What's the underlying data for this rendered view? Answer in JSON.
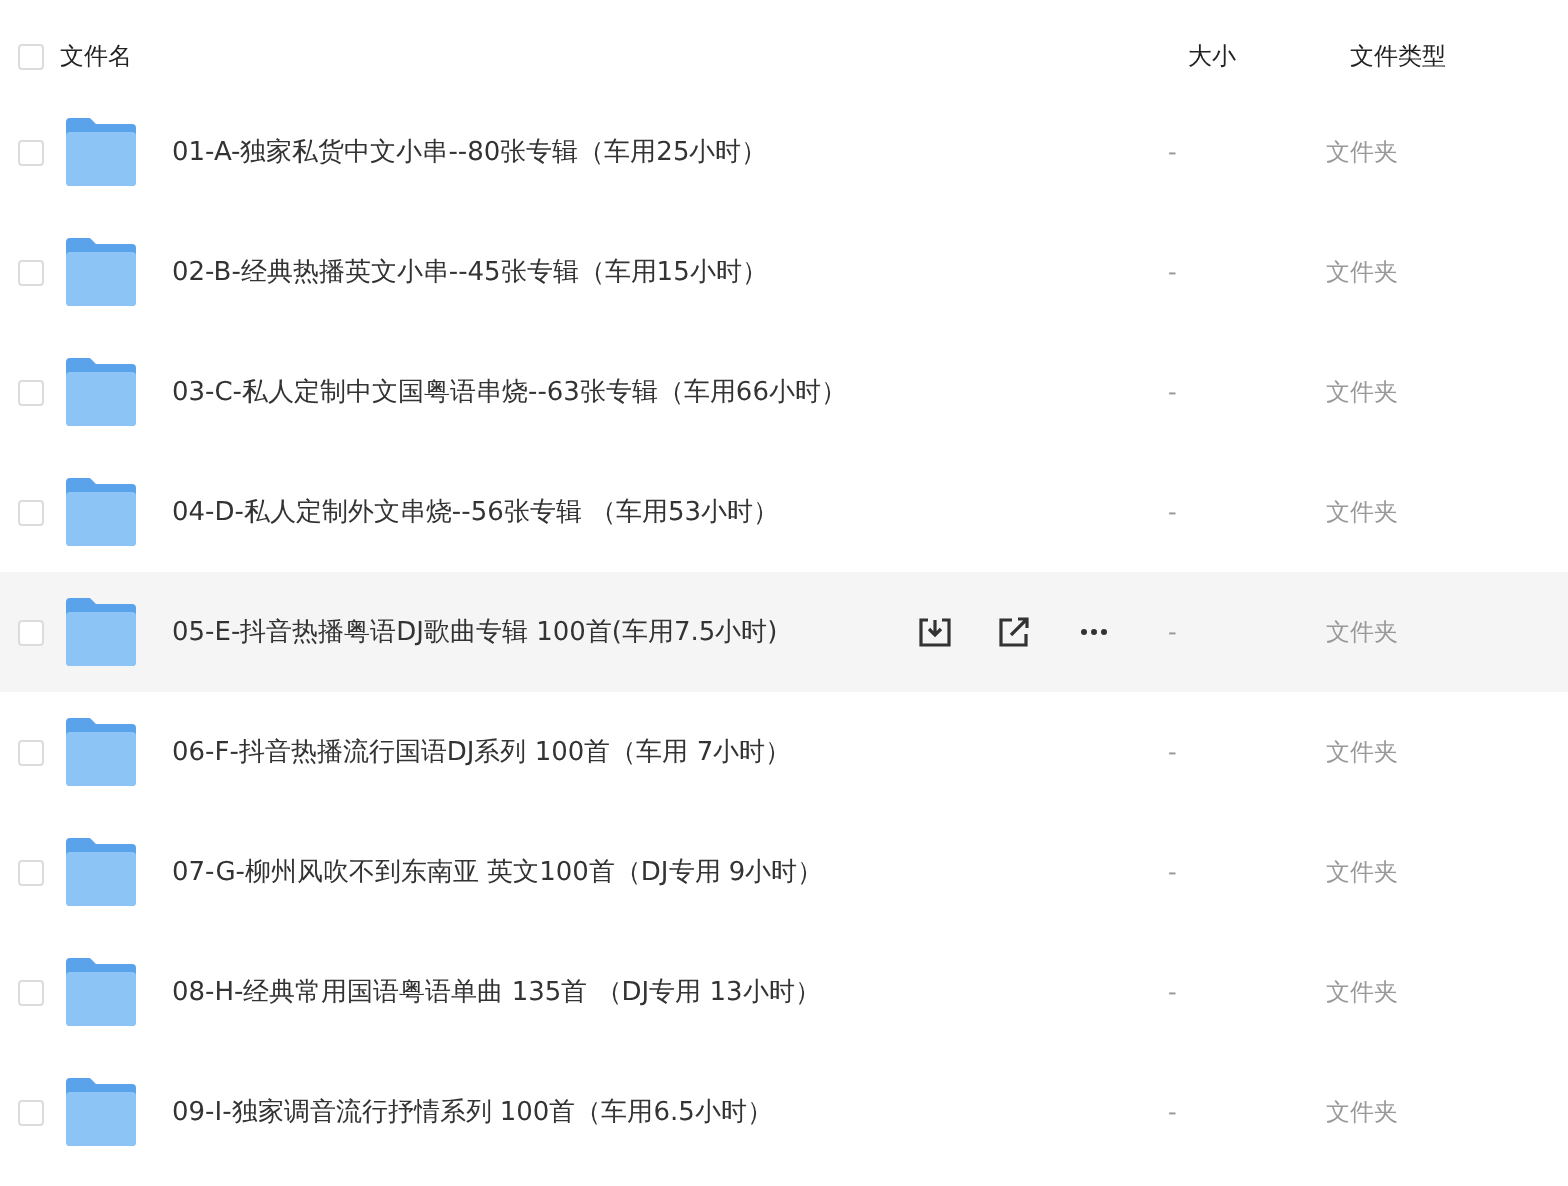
{
  "header": {
    "select_all_checked": false,
    "columns": [
      "文件名",
      "大小",
      "文件类型"
    ]
  },
  "rows": [
    {
      "name": "01-A-独家私货中文小串--80张专辑（车用25小时）",
      "size": "-",
      "type": "文件夹",
      "checked": false,
      "hovered": false
    },
    {
      "name": "02-B-经典热播英文小串--45张专辑（车用15小时）",
      "size": "-",
      "type": "文件夹",
      "checked": false,
      "hovered": false
    },
    {
      "name": "03-C-私人定制中文国粤语串烧--63张专辑（车用66小时）",
      "size": "-",
      "type": "文件夹",
      "checked": false,
      "hovered": false
    },
    {
      "name": "04-D-私人定制外文串烧--56张专辑 （车用53小时）",
      "size": "-",
      "type": "文件夹",
      "checked": false,
      "hovered": false
    },
    {
      "name": "05-E-抖音热播粤语DJ歌曲专辑 100首(车用7.5小时)",
      "size": "-",
      "type": "文件夹",
      "checked": false,
      "hovered": true
    },
    {
      "name": "06-F-抖音热播流行国语DJ系列 100首（车用 7小时）",
      "size": "-",
      "type": "文件夹",
      "checked": false,
      "hovered": false
    },
    {
      "name": "07-G-柳州风吹不到东南亚 英文100首（DJ专用 9小时）",
      "size": "-",
      "type": "文件夹",
      "checked": false,
      "hovered": false
    },
    {
      "name": "08-H-经典常用国语粤语单曲 135首 （DJ专用 13小时）",
      "size": "-",
      "type": "文件夹",
      "checked": false,
      "hovered": false
    },
    {
      "name": "09-I-独家调音流行抒情系列 100首（车用6.5小时）",
      "size": "-",
      "type": "文件夹",
      "checked": false,
      "hovered": false
    }
  ]
}
